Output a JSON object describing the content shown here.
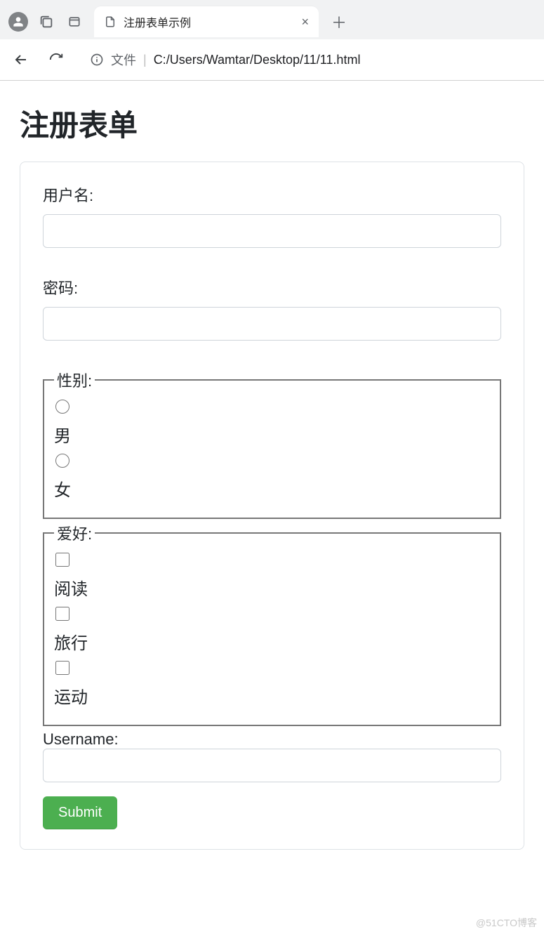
{
  "browser": {
    "tab_title": "注册表单示例",
    "address_prefix": "文件",
    "address_path": "C:/Users/Wamtar/Desktop/11/11.html"
  },
  "page": {
    "heading": "注册表单",
    "username_label": "用户名:",
    "password_label": "密码:",
    "gender": {
      "legend": "性别:",
      "options": [
        "男",
        "女"
      ]
    },
    "hobby": {
      "legend": "爱好:",
      "options": [
        "阅读",
        "旅行",
        "运动"
      ]
    },
    "username2_label": "Username:",
    "submit_label": "Submit"
  },
  "watermark": "@51CTO博客"
}
